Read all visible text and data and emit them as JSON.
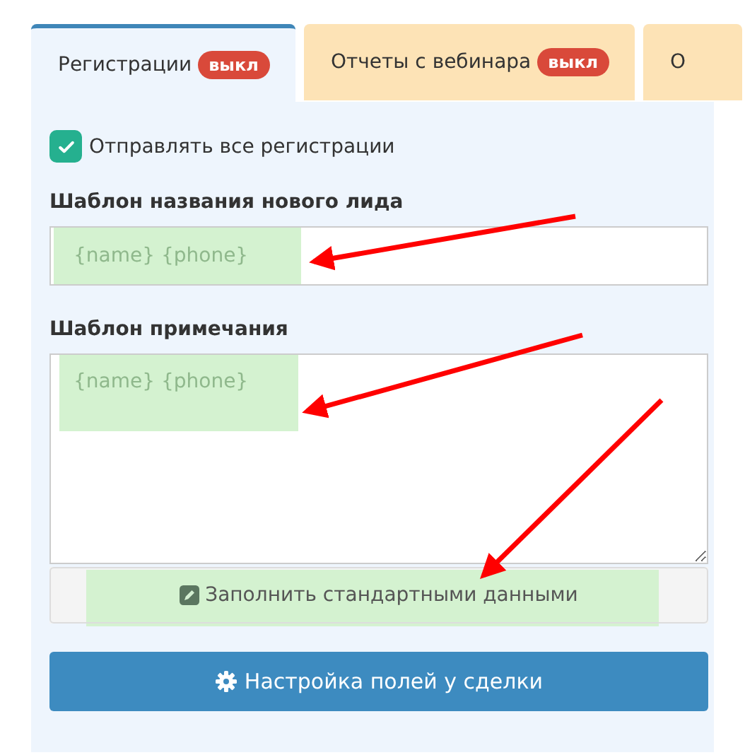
{
  "tabs": [
    {
      "label": "Регистрации",
      "badge": "выкл",
      "selected": true
    },
    {
      "label": "Отчеты с вебинара",
      "badge": "выкл",
      "selected": false
    },
    {
      "label": "О",
      "selected": false
    }
  ],
  "send_all": {
    "label": "Отправлять все регистрации",
    "checked": true
  },
  "lead_template": {
    "label": "Шаблон названия нового лида",
    "placeholder": "{name} {phone}"
  },
  "note_template": {
    "label": "Шаблон примечания",
    "placeholder": "{name} {phone}"
  },
  "fill_button": "Заполнить стандартными данными",
  "settings_button": "Настройка полей у сделки"
}
